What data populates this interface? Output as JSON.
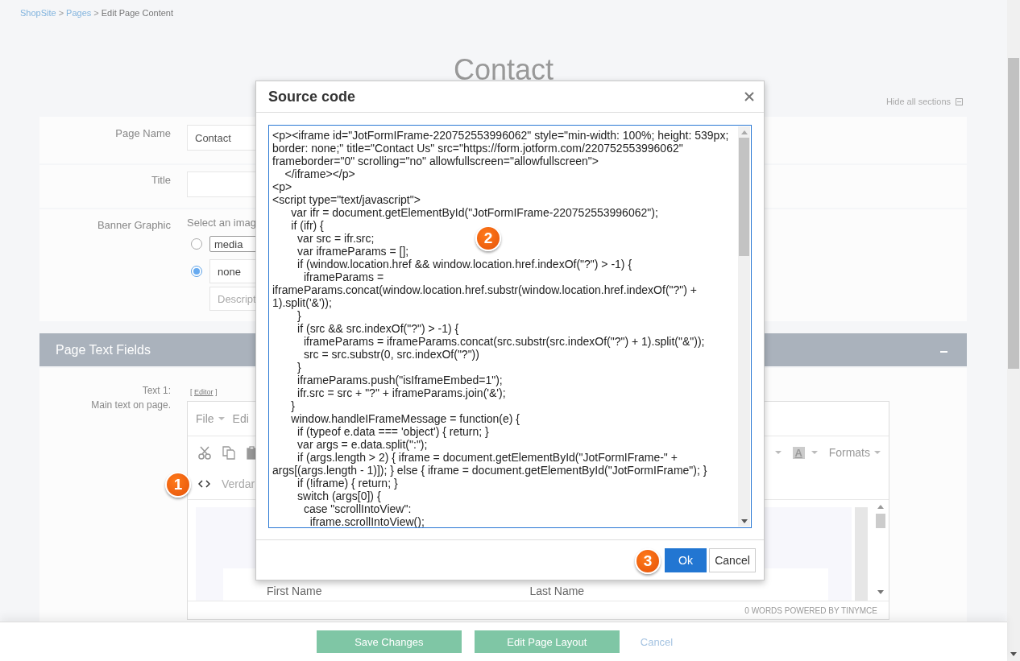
{
  "breadcrumb": [
    {
      "label": "ShopSite",
      "kind": "link"
    },
    {
      "label": ">",
      "kind": "separator"
    },
    {
      "label": "Pages",
      "kind": "link"
    },
    {
      "label": ">",
      "kind": "separator"
    },
    {
      "label": "Edit Page Content",
      "kind": "current"
    }
  ],
  "page_title": "Contact",
  "hide_all_sections": "Hide all sections",
  "fields": [
    {
      "label": "Page Name",
      "value": "Contact"
    },
    {
      "label": "Title"
    }
  ],
  "banner": {
    "label": "Banner Graphic",
    "prompt": "Select an imag",
    "options": [
      {
        "value": "media",
        "kind": "select",
        "selected": false
      },
      {
        "value": "none",
        "kind": "text",
        "selected": true
      }
    ],
    "description_placeholder": "Descript"
  },
  "section": {
    "title": "Page Text Fields"
  },
  "text_field": {
    "label": "Text 1:",
    "hint": "Main text on page.",
    "editor_link": {
      "open": "[",
      "label": "Editor",
      "close": "]"
    }
  },
  "editor": {
    "menu": [
      {
        "label": "File",
        "caret": true
      },
      {
        "label": "Edi",
        "caret": false
      }
    ],
    "text_color_glyph": "A",
    "formats": "Formats",
    "font": "Verdar",
    "form_labels": [
      "First Name",
      "Last Name"
    ],
    "status": "0 WORDS POWERED BY TINYMCE"
  },
  "dialog": {
    "title": "Source code",
    "code_lines": [
      "<p><iframe id=\"JotFormIFrame-220752553996062\" style=\"min-width: 100%; height: 539px;",
      "border: none;\" title=\"Contact Us\" src=\"https://form.jotform.com/220752553996062\"",
      "frameborder=\"0\" scrolling=\"no\" allowfullscreen=\"allowfullscreen\">",
      "    </iframe></p>",
      "<p>",
      "<script type=\"text/javascript\">",
      "      var ifr = document.getElementById(\"JotFormIFrame-220752553996062\");",
      "      if (ifr) {",
      "        var src = ifr.src;",
      "        var iframeParams = [];",
      "        if (window.location.href && window.location.href.indexOf(\"?\") > -1) {",
      "          iframeParams =",
      "iframeParams.concat(window.location.href.substr(window.location.href.indexOf(\"?\") +",
      "1).split('&'));",
      "        }",
      "        if (src && src.indexOf(\"?\") > -1) {",
      "          iframeParams = iframeParams.concat(src.substr(src.indexOf(\"?\") + 1).split(\"&\"));",
      "          src = src.substr(0, src.indexOf(\"?\"))",
      "        }",
      "        iframeParams.push(\"isIframeEmbed=1\");",
      "        ifr.src = src + \"?\" + iframeParams.join('&');",
      "      }",
      "      window.handleIFrameMessage = function(e) {",
      "        if (typeof e.data === 'object') { return; }",
      "        var args = e.data.split(\":\");",
      "        if (args.length > 2) { iframe = document.getElementById(\"JotFormIFrame-\" +",
      "args[(args.length - 1)]); } else { iframe = document.getElementById(\"JotFormIFrame\"); }",
      "        if (!iframe) { return; }",
      "        switch (args[0]) {",
      "          case \"scrollIntoView\":",
      "            iframe.scrollIntoView();"
    ],
    "buttons": [
      {
        "label": "Ok",
        "kind": "primary"
      },
      {
        "label": "Cancel",
        "kind": "secondary"
      }
    ]
  },
  "badges": [
    "1",
    "2",
    "3"
  ],
  "footer": {
    "buttons": [
      {
        "label": "Save Changes",
        "kind": "primary"
      },
      {
        "label": "Edit Page Layout",
        "kind": "primary"
      },
      {
        "label": "Cancel",
        "kind": "link"
      }
    ]
  }
}
